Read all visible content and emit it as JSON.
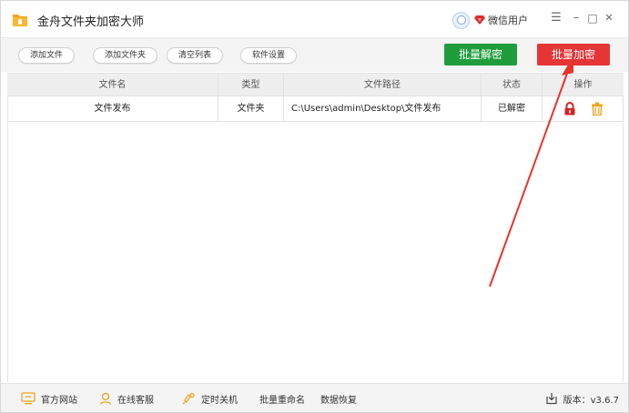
{
  "app": {
    "title": "金舟文件夹加密大师"
  },
  "user": {
    "name": "微信用户"
  },
  "window_controls": {
    "menu": "☰",
    "minimize": "–",
    "maximize": "□",
    "close": "✕"
  },
  "toolbar": {
    "add_file": "添加文件",
    "add_folder": "添加文件夹",
    "clear_list": "清空列表",
    "settings": "软件设置",
    "batch_decrypt": "批量解密",
    "batch_encrypt": "批量加密"
  },
  "table": {
    "headers": [
      "文件名",
      "类型",
      "文件路径",
      "状态",
      "操作"
    ],
    "rows": [
      {
        "name": "文件发布",
        "type": "文件夹",
        "path": "C:\\Users\\admin\\Desktop\\文件发布",
        "status": "已解密"
      }
    ]
  },
  "statusbar": {
    "website": "官方网站",
    "support": "在线客服",
    "shutdown": "定时关机",
    "rename": "批量重命名",
    "recovery": "数据恢复",
    "version": "版本：v3.6.7"
  },
  "colors": {
    "decrypt_btn": "#1f9d3c",
    "encrypt_btn": "#e63535",
    "annotation": "#e8342a",
    "lock_icon": "#d42323",
    "trash_icon": "#f0a21a"
  },
  "icons": [
    "folder-logo-icon",
    "avatar-icon",
    "vip-diamond-icon",
    "lock-icon",
    "trash-icon",
    "monitor-icon",
    "support-icon",
    "timer-icon",
    "download-icon"
  ]
}
